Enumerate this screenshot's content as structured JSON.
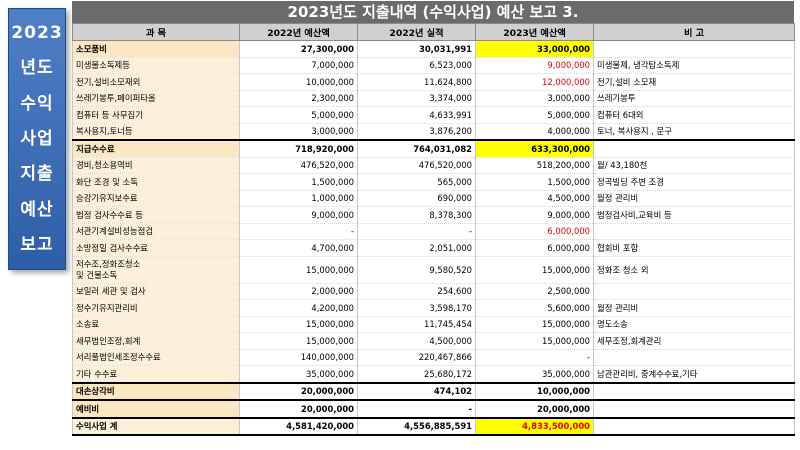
{
  "side_title": [
    "2023",
    "년도",
    "수익",
    "사업",
    "지출",
    "예산",
    "보고"
  ],
  "title": "2023년도 지출내역 (수익사업) 예산 보고 3.",
  "headers": [
    "과  목",
    "2022년 예산액",
    "2022년 실적",
    "2023년 예산액",
    "비        고"
  ],
  "rows": [
    {
      "item": "소모품비",
      "b2022": "27,300,000",
      "a2022": "30,031,991",
      "b2023": "33,000,000",
      "note": "",
      "kind": "group",
      "hl": true
    },
    {
      "item": "미생물소독제등",
      "b2022": "7,000,000",
      "a2022": "6,523,000",
      "b2023": "9,000,000",
      "note": "미생물제, 냉각탑소독제",
      "red": true
    },
    {
      "item": "전기,설비소모재외",
      "b2022": "10,000,000",
      "a2022": "11,624,800",
      "b2023": "12,000,000",
      "note": "전기,설비 소모재",
      "red": true
    },
    {
      "item": "쓰레기봉투,페이퍼타올",
      "b2022": "2,300,000",
      "a2022": "3,374,000",
      "b2023": "3,000,000",
      "note": "쓰레기봉투"
    },
    {
      "item": "컴퓨터 등 사무집기",
      "b2022": "5,000,000",
      "a2022": "4,633,991",
      "b2023": "5,000,000",
      "note": "컴퓨터 6대외"
    },
    {
      "item": "복사용지,토너등",
      "b2022": "3,000,000",
      "a2022": "3,876,200",
      "b2023": "4,000,000",
      "note": "토너, 복사용지 , 문구"
    },
    {
      "item": "지급수수료",
      "b2022": "718,920,000",
      "a2022": "764,031,082",
      "b2023": "633,300,000",
      "note": "",
      "kind": "group",
      "hl": true,
      "sep": true
    },
    {
      "item": "경비,청소용역비",
      "b2022": "476,520,000",
      "a2022": "476,520,000",
      "b2023": "518,200,000",
      "note": "월/ 43,180천"
    },
    {
      "item": "화단 조경 및 소독",
      "b2022": "1,500,000",
      "a2022": "565,000",
      "b2023": "1,500,000",
      "note": "정곡빌딩 주변 조경"
    },
    {
      "item": "승강기유지보수료",
      "b2022": "1,000,000",
      "a2022": "690,000",
      "b2023": "4,500,000",
      "note": "월정 관리비"
    },
    {
      "item": "법정 검사수수료 등",
      "b2022": "9,000,000",
      "a2022": "8,378,300",
      "b2023": "9,000,000",
      "note": "법정검사비,교육비 등"
    },
    {
      "item": "서관기계설비성능점검",
      "b2022": "-",
      "a2022": "-",
      "b2023": "6,000,000",
      "note": "",
      "red": true
    },
    {
      "item": "소방정밀 검사수수료",
      "b2022": "4,700,000",
      "a2022": "2,051,000",
      "b2023": "6,000,000",
      "note": "협회비 포함"
    },
    {
      "item": "저수조,정화조청소\n및 건물소독",
      "b2022": "15,000,000",
      "a2022": "9,580,520",
      "b2023": "15,000,000",
      "note": "정화조 청소 외",
      "tall": true
    },
    {
      "item": "보일러 세관 및 검사",
      "b2022": "2,000,000",
      "a2022": "254,600",
      "b2023": "2,500,000",
      "note": ""
    },
    {
      "item": "정수기유지관리비",
      "b2022": "4,200,000",
      "a2022": "3,598,170",
      "b2023": "5,600,000",
      "note": "월정 관리비"
    },
    {
      "item": "소송료",
      "b2022": "15,000,000",
      "a2022": "11,745,454",
      "b2023": "15,000,000",
      "note": "명도소송"
    },
    {
      "item": "세무법인조정,회계",
      "b2022": "15,000,000",
      "a2022": "4,500,000",
      "b2023": "15,000,000",
      "note": "세무조정,회계관리"
    },
    {
      "item": "서리풀법인세조정수수료",
      "b2022": "140,000,000",
      "a2022": "220,467,866",
      "b2023": "-",
      "note": ""
    },
    {
      "item": "기타 수수료",
      "b2022": "35,000,000",
      "a2022": "25,680,172",
      "b2023": "35,000,000",
      "note": "남관관리비, 중계수수료,기타"
    },
    {
      "item": "대손상각비",
      "b2022": "20,000,000",
      "a2022": "474,102",
      "b2023": "10,000,000",
      "note": "",
      "kind": "group",
      "sep": true
    },
    {
      "item": "예비비",
      "b2022": "20,000,000",
      "a2022": "-",
      "b2023": "20,000,000",
      "note": "",
      "kind": "group",
      "sep": true
    },
    {
      "item": "수익사업    계",
      "b2022": "4,581,420,000",
      "a2022": "4,556,885,591",
      "b2023": "4,833,500,000",
      "note": "",
      "kind": "total",
      "hl": true,
      "red": true
    }
  ]
}
